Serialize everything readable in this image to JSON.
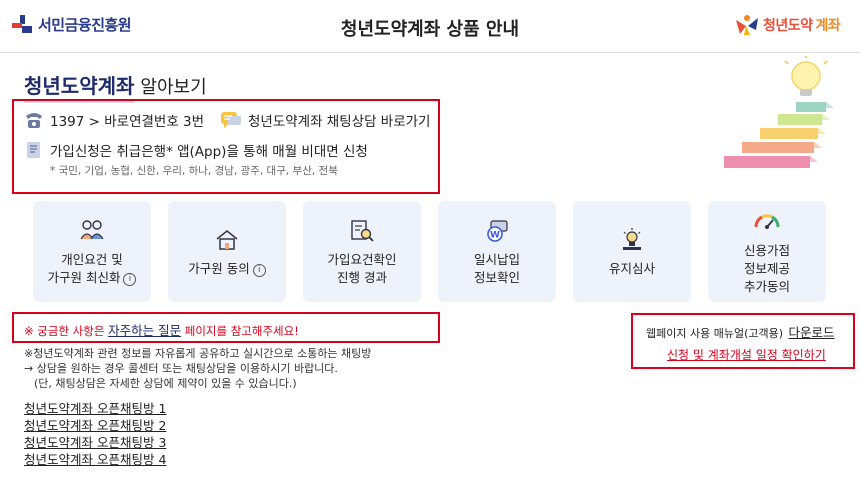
{
  "header": {
    "left_logo": "서민금융진흥원",
    "title": "청년도약계좌 상품 안내",
    "right_logo_part1": "청년도약",
    "right_logo_part2": "계좌"
  },
  "section": {
    "title_main": "청년도약계좌",
    "title_sub": "알아보기"
  },
  "contact": {
    "phone_text": "1397 > 바로연결번호 3번",
    "chat_link": "청년도약계좌 채팅상담 바로가기",
    "apply_text": "가입신청은 취급은행* 앱(App)을 통해 매월 비대면 신청",
    "banks_note": "* 국민, 기업, 농협, 신한, 우리, 하나, 경남, 광주, 대구, 부산, 전북"
  },
  "tiles": [
    {
      "line1": "개인요건 및",
      "line2": "가구원 최신화",
      "info": "i"
    },
    {
      "line1": "가구원 동의",
      "info": "i"
    },
    {
      "line1": "가입요건확인",
      "line2": "진행 경과"
    },
    {
      "line1": "일시납입",
      "line2": "정보확인"
    },
    {
      "line1": "유지심사"
    },
    {
      "line1": "신용가점",
      "line2": "정보제공",
      "line3": "추가동의"
    }
  ],
  "faq": {
    "prefix": "※ 궁금한 사항은",
    "link": "자주하는 질문",
    "suffix": "페이지를 참고해주세요!"
  },
  "manual": {
    "text": "웹페이지 사용 매뉴얼(고객용)",
    "download": "다운로드",
    "schedule_link": "신청 및 계좌개설 일정 확인하기"
  },
  "notes": {
    "line1": "※청년도약계좌 관련 정보를 자유롭게 공유하고 실시간으로 소통하는 채팅방",
    "line2": "→ 상담을 원하는 경우 콜센터 또는 채팅상담을 이용하시기 바랍니다.",
    "line3": "(단, 채팅상담은 자세한 상담에 제약이 있을 수 있습니다.)"
  },
  "chat_rooms": [
    "청년도약계좌 오픈채팅방 1",
    "청년도약계좌 오픈채팅방 2",
    "청년도약계좌 오픈채팅방 3",
    "청년도약계좌 오픈채팅방 4"
  ],
  "colors": {
    "highlight_red": "#d9001b",
    "tile_bg": "#eef3fb",
    "brand_navy": "#1d2a6b"
  }
}
